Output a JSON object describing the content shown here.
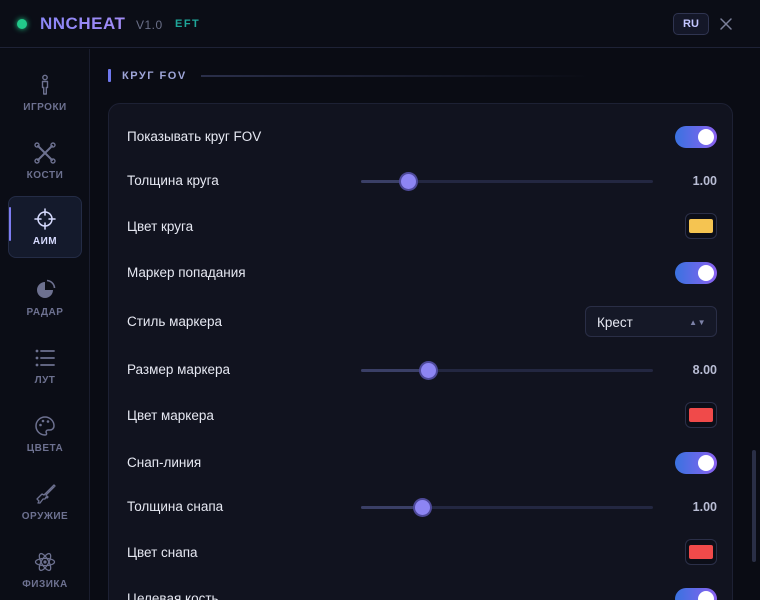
{
  "app": {
    "title": "NNCHEAT",
    "version": "V1.0",
    "game": "EFT",
    "lang_label": "RU"
  },
  "sidebar": {
    "items": [
      {
        "label": "ИГРОКИ",
        "icon": "person-icon"
      },
      {
        "label": "КОСТИ",
        "icon": "bones-icon"
      },
      {
        "label": "АИМ",
        "icon": "crosshair-icon",
        "active": true
      },
      {
        "label": "РАДАР",
        "icon": "radar-icon"
      },
      {
        "label": "ЛУТ",
        "icon": "list-icon"
      },
      {
        "label": "ЦВЕТА",
        "icon": "palette-icon"
      },
      {
        "label": "ОРУЖИЕ",
        "icon": "rifle-icon"
      },
      {
        "label": "ФИЗИКА",
        "icon": "atom-icon"
      }
    ]
  },
  "section": {
    "title": "КРУГ FOV"
  },
  "settings": {
    "show_fov": {
      "label": "Показывать круг FOV",
      "enabled": true
    },
    "circle_thickness": {
      "label": "Толщина круга",
      "value": "1.00",
      "fraction": 0.16
    },
    "circle_color": {
      "label": "Цвет круга",
      "color": "#f5c451"
    },
    "hit_marker": {
      "label": "Маркер попадания",
      "enabled": true
    },
    "marker_style": {
      "label": "Стиль маркера",
      "value": "Крест",
      "icon_text": "▲▼"
    },
    "marker_size": {
      "label": "Размер маркера",
      "value": "8.00",
      "fraction": 0.23
    },
    "marker_color": {
      "label": "Цвет маркера",
      "color": "#f04a4a"
    },
    "snap_line": {
      "label": "Снап-линия",
      "enabled": true
    },
    "snap_thickness": {
      "label": "Толщина снапа",
      "value": "1.00",
      "fraction": 0.21
    },
    "snap_color": {
      "label": "Цвет снапа",
      "color": "#f04a4a"
    },
    "target_bone": {
      "label": "Целевая кость",
      "enabled": true
    }
  },
  "colors": {
    "accent": "#7d7cf2",
    "online": "#22c98a",
    "game_tag": "#1fa69a"
  }
}
